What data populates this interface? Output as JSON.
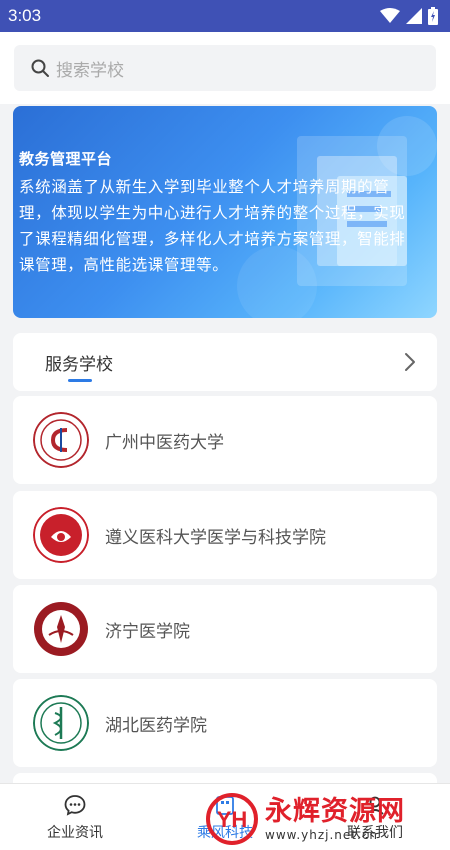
{
  "status_bar": {
    "time": "3:03"
  },
  "search": {
    "placeholder": "搜索学校"
  },
  "banner": {
    "title": "教务管理平台",
    "description": "系统涵盖了从新生入学到毕业整个人才培养周期的管理，体现以学生为中心进行人才培养的整个过程，实现了课程精细化管理，多样化人才培养方案管理，智能排课管理，高性能选课管理等。"
  },
  "service": {
    "title": "服务学校"
  },
  "schools": [
    {
      "name": "广州中医药大学",
      "logo_color": "#b3262d"
    },
    {
      "name": "遵义医科大学医学与科技学院",
      "logo_color": "#c8202b"
    },
    {
      "name": "济宁医学院",
      "logo_color": "#9b1b22"
    },
    {
      "name": "湖北医药学院",
      "logo_color": "#1d7a55"
    }
  ],
  "nav": {
    "items": [
      {
        "label": "企业资讯",
        "icon": "chat-icon",
        "active": false
      },
      {
        "label": "乘风科技",
        "icon": "building-icon",
        "active": true
      },
      {
        "label": "联系我们",
        "icon": "contact-icon",
        "active": false
      }
    ]
  },
  "watermark": {
    "title": "永辉资源网",
    "url": "www.yhzj.net.cn",
    "logo_letters": "YH"
  },
  "colors": {
    "status_bar": "#3f51b5",
    "accent": "#2d7be5",
    "watermark": "#e0212b"
  }
}
